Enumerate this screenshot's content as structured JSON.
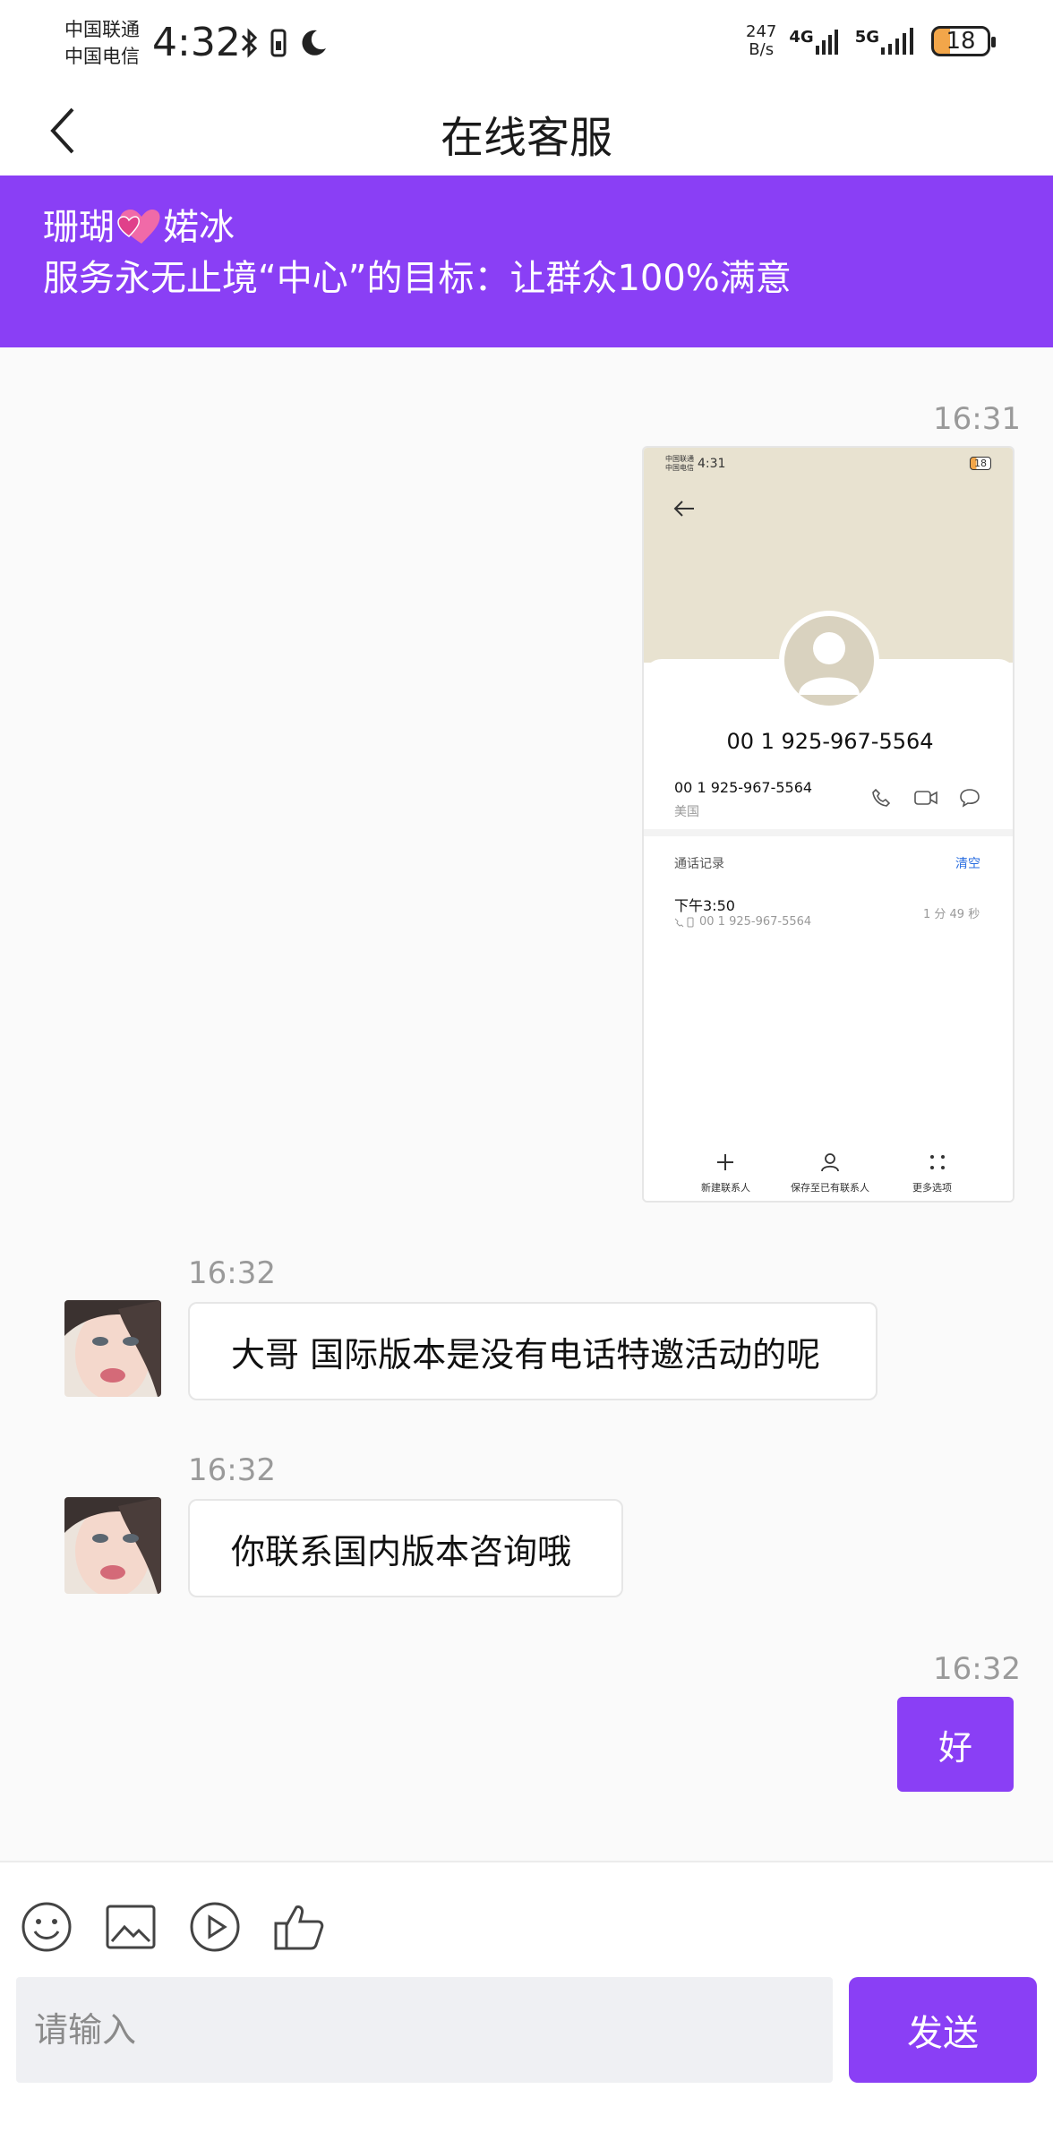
{
  "status_bar": {
    "carrier_1": "中国联通",
    "carrier_2": "中国电信",
    "time": "4:32",
    "net_speed_value": "247",
    "net_speed_unit": "B/s",
    "signal_1": "4G",
    "signal_2": "5G",
    "battery": "18"
  },
  "header": {
    "title": "在线客服"
  },
  "banner": {
    "name_part_1": "珊瑚",
    "name_part_2": "婼冰",
    "slogan": "服务永无止境“中心”的目标：让群众100%满意",
    "color": "#8a3ff5"
  },
  "messages": [
    {
      "time": "16:31",
      "side": "right",
      "type": "image",
      "screenshot": {
        "status_carrier_1": "中国联通",
        "status_carrier_2": "中国电信",
        "status_time": "4:31",
        "status_battery": "18",
        "number_title": "00 1 925-967-5564",
        "number_row": "00 1 925-967-5564",
        "region": "美国",
        "call_log_label": "通话记录",
        "clear_label": "清空",
        "call_time": "下午3:50",
        "call_number": "00 1 925-967-5564",
        "call_duration": "1 分 49 秒",
        "new_contact": "新建联系人",
        "save_existing": "保存至已有联系人",
        "more_options": "更多选项"
      }
    },
    {
      "time": "16:32",
      "side": "left",
      "type": "text",
      "text": "大哥 国际版本是没有电话特邀活动的呢"
    },
    {
      "time": "16:32",
      "side": "left",
      "type": "text",
      "text": "你联系国内版本咨询哦"
    },
    {
      "time": "16:32",
      "side": "right",
      "type": "text",
      "text": "好"
    }
  ],
  "composer": {
    "placeholder": "请输入",
    "send_label": "发送",
    "tools": [
      "emoji-icon",
      "image-icon",
      "video-icon",
      "thumbs-up-icon"
    ]
  }
}
